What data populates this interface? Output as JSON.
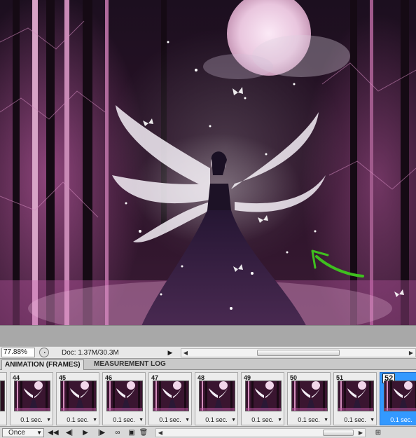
{
  "status_bar": {
    "zoom": "77.88%",
    "doc_info": "Doc: 1.37M/30.3M"
  },
  "panel_tabs": [
    {
      "label": "ANIMATION (FRAMES)"
    },
    {
      "label": "MEASUREMENT LOG"
    }
  ],
  "frames": [
    {
      "number": "44",
      "delay": "0.1 sec."
    },
    {
      "number": "45",
      "delay": "0.1 sec."
    },
    {
      "number": "46",
      "delay": "0.1 sec."
    },
    {
      "number": "47",
      "delay": "0.1 sec."
    },
    {
      "number": "48",
      "delay": "0.1 sec."
    },
    {
      "number": "49",
      "delay": "0.1 sec."
    },
    {
      "number": "50",
      "delay": "0.1 sec."
    },
    {
      "number": "51",
      "delay": "0.1 sec."
    },
    {
      "number": "52",
      "delay": "0.1 sec."
    }
  ],
  "selected_frame": "52",
  "animation_toolbar": {
    "loop": "Once"
  },
  "colors": {
    "selection": "#3399ff",
    "arrow_annotation": "#3fbf1f",
    "canvas_tint": "#c04a9a"
  },
  "icons": [
    "zoom-icon",
    "menu-arrow-icon",
    "first-frame-icon",
    "previous-frame-icon",
    "play-icon",
    "next-frame-icon",
    "tween-icon",
    "duplicate-frame-icon",
    "delete-frame-icon",
    "panel-mode-icon"
  ]
}
